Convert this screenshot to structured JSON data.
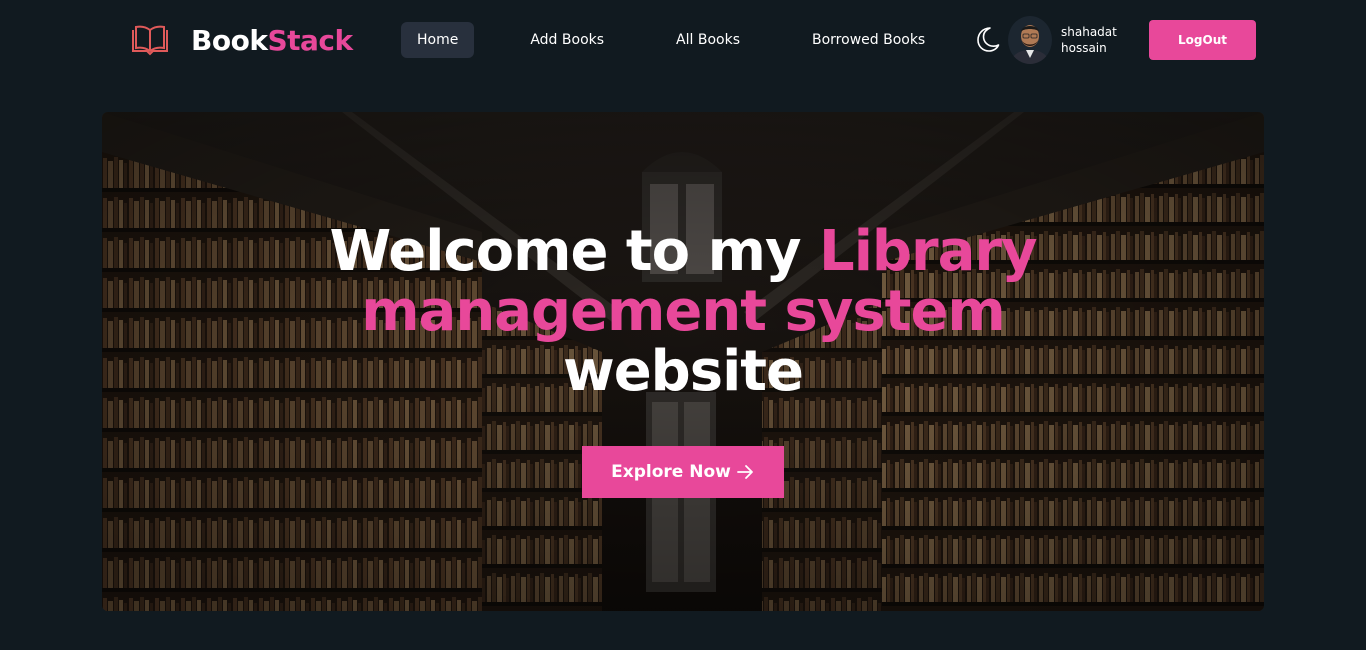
{
  "brand": {
    "name_part1": "Book",
    "name_part2": "Stack",
    "icon": "open-book-icon"
  },
  "nav": {
    "items": [
      {
        "label": "Home",
        "active": true
      },
      {
        "label": "Add Books",
        "active": false
      },
      {
        "label": "All Books",
        "active": false
      },
      {
        "label": "Borrowed Books",
        "active": false
      }
    ],
    "theme_icon": "moon-icon",
    "user": {
      "first_name": "shahadat",
      "last_name": "hossain"
    },
    "logout_label": "LogOut"
  },
  "hero": {
    "title_line1_white": "Welcome to my ",
    "title_line1_pink": "Library",
    "title_line2_pink": "management system",
    "title_line3_white": "website",
    "cta_label": "Explore Now",
    "cta_icon": "arrow-right-icon"
  },
  "colors": {
    "background": "#111a20",
    "accent": "#e8489a",
    "active_nav": "#28303d"
  }
}
